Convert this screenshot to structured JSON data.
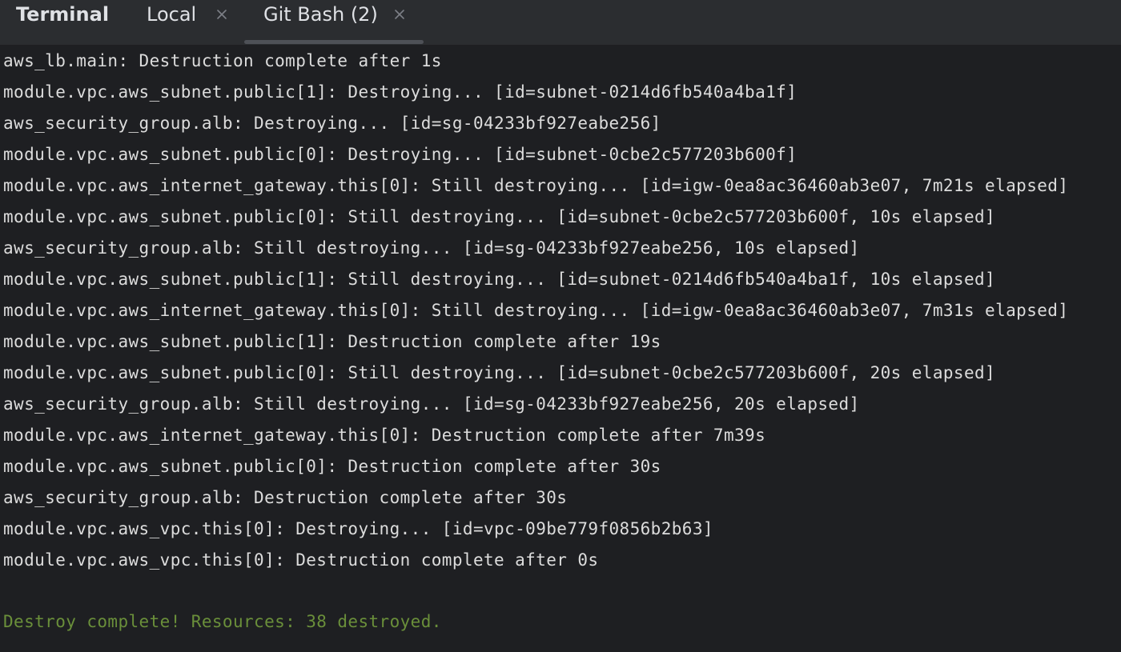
{
  "tool_window": {
    "title": "Terminal",
    "tabs": [
      {
        "label": "Local",
        "closable": true,
        "active": false
      },
      {
        "label": "Git Bash (2)",
        "closable": true,
        "active": true
      }
    ]
  },
  "colors": {
    "tabbar_background": "#2b2d30",
    "terminal_background": "#1e1f22",
    "text": "#dcdcdc",
    "success_text": "#6a8f3a",
    "active_tab_indicator": "#4e5157"
  },
  "icons": {
    "tab_close": "close-icon"
  },
  "terminal": {
    "lines": [
      "aws_lb.main: Destruction complete after 1s",
      "module.vpc.aws_subnet.public[1]: Destroying... [id=subnet-0214d6fb540a4ba1f]",
      "aws_security_group.alb: Destroying... [id=sg-04233bf927eabe256]",
      "module.vpc.aws_subnet.public[0]: Destroying... [id=subnet-0cbe2c577203b600f]",
      "module.vpc.aws_internet_gateway.this[0]: Still destroying... [id=igw-0ea8ac36460ab3e07, 7m21s elapsed]",
      "module.vpc.aws_subnet.public[0]: Still destroying... [id=subnet-0cbe2c577203b600f, 10s elapsed]",
      "aws_security_group.alb: Still destroying... [id=sg-04233bf927eabe256, 10s elapsed]",
      "module.vpc.aws_subnet.public[1]: Still destroying... [id=subnet-0214d6fb540a4ba1f, 10s elapsed]",
      "module.vpc.aws_internet_gateway.this[0]: Still destroying... [id=igw-0ea8ac36460ab3e07, 7m31s elapsed]",
      "module.vpc.aws_subnet.public[1]: Destruction complete after 19s",
      "module.vpc.aws_subnet.public[0]: Still destroying... [id=subnet-0cbe2c577203b600f, 20s elapsed]",
      "aws_security_group.alb: Still destroying... [id=sg-04233bf927eabe256, 20s elapsed]",
      "module.vpc.aws_internet_gateway.this[0]: Destruction complete after 7m39s",
      "module.vpc.aws_subnet.public[0]: Destruction complete after 30s",
      "aws_security_group.alb: Destruction complete after 30s",
      "module.vpc.aws_vpc.this[0]: Destroying... [id=vpc-09be779f0856b2b63]",
      "module.vpc.aws_vpc.this[0]: Destruction complete after 0s"
    ],
    "success_message": "Destroy complete! Resources: 38 destroyed."
  }
}
